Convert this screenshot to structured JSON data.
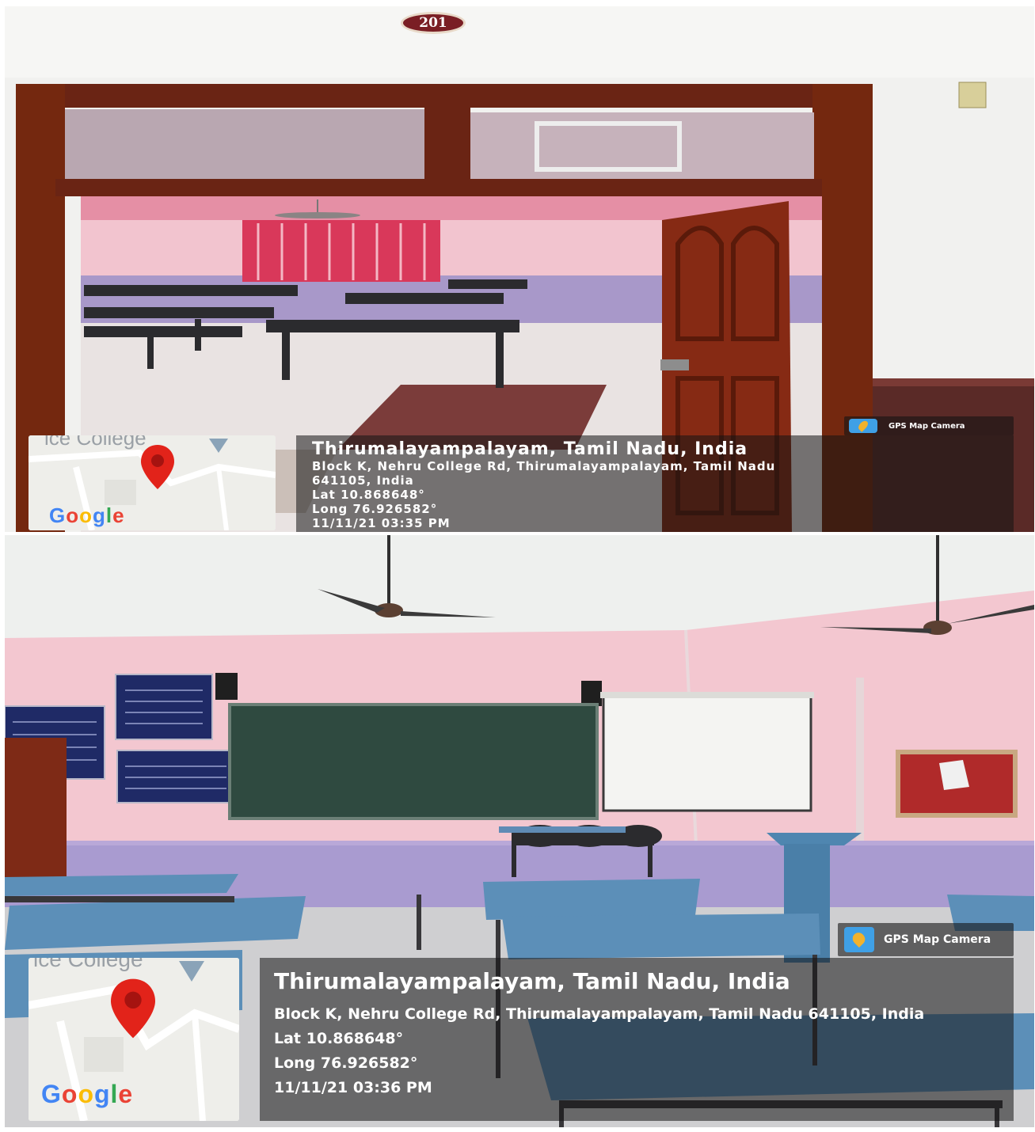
{
  "photos": [
    {
      "room_number": "201",
      "map": {
        "partial_label": "ice College",
        "logo": "Google"
      },
      "badge": {
        "label": "GPS Map Camera"
      },
      "location": {
        "title": "Thirumalayampalayam, Tamil Nadu, India",
        "address": "Block K, Nehru College Rd, Thirumalayampalayam, Tamil Nadu 641105, India",
        "address_line1": "Block K, Nehru College Rd, Thirumalayampalayam, Tamil Nadu",
        "address_line2": "641105, India",
        "lat": "Lat 10.868648°",
        "long": "Long 76.926582°",
        "datetime": "11/11/21 03:35 PM"
      }
    },
    {
      "map": {
        "partial_label": "ice College",
        "logo": "Google"
      },
      "badge": {
        "label": "GPS Map Camera"
      },
      "location": {
        "title": "Thirumalayampalayam, Tamil Nadu, India",
        "address": "Block K, Nehru College Rd, Thirumalayampalayam, Tamil Nadu 641105, India",
        "lat": "Lat 10.868648°",
        "long": "Long 76.926582°",
        "datetime": "11/11/21 03:36 PM"
      }
    }
  ]
}
